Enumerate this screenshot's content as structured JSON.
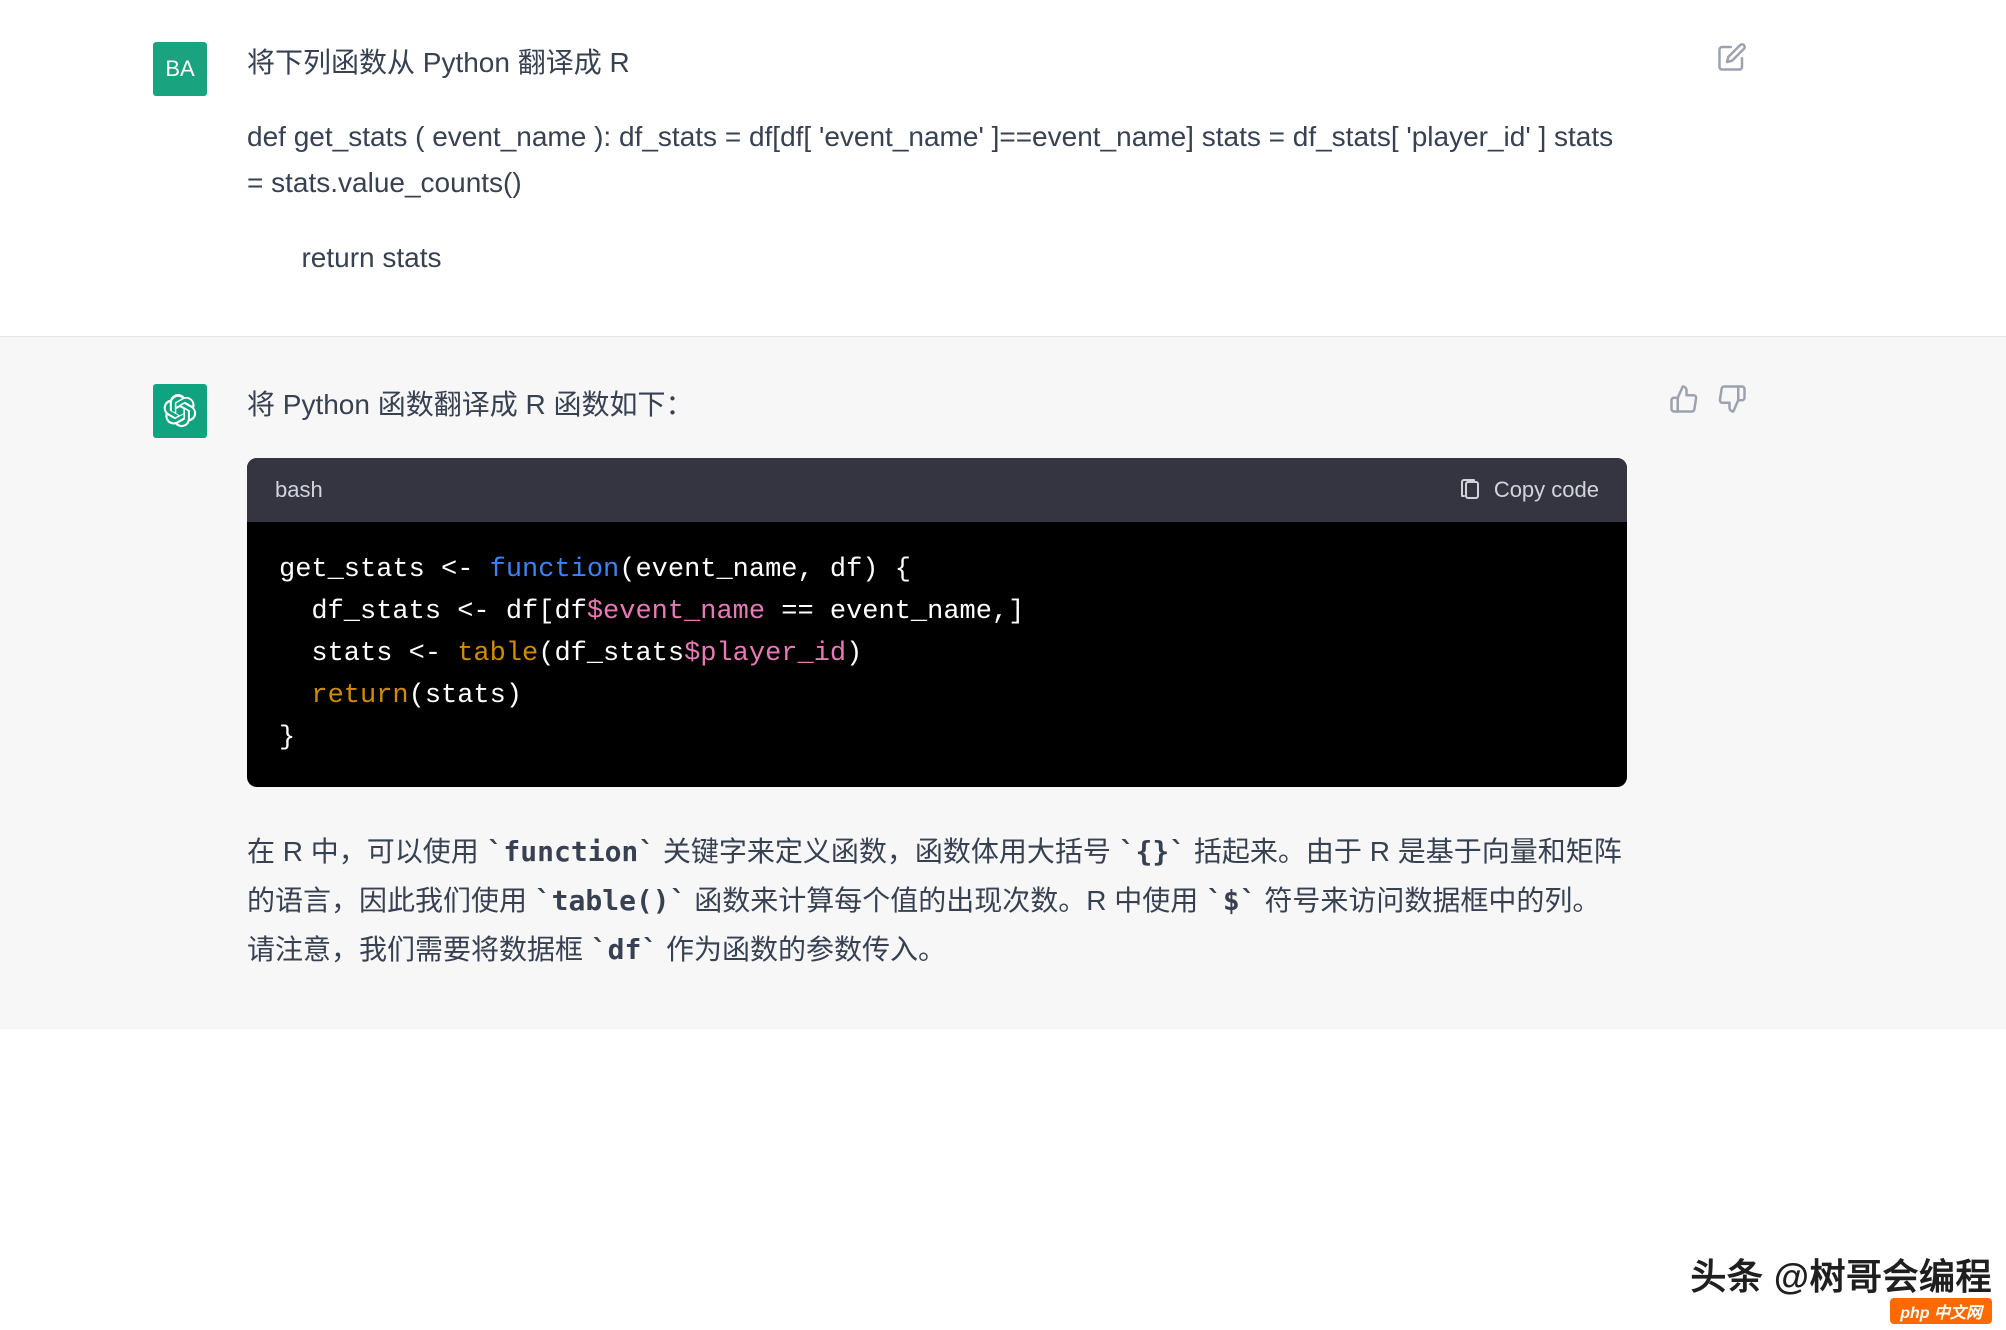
{
  "user": {
    "avatar_label": "BA",
    "prompt_line1": "将下列函数从 Python 翻译成 R",
    "code_line1": "def get_stats ( event_name ):       df_stats = df[df[ 'event_name' ]==event_name]       stats = df_stats[ 'player_id' ]       stats = stats.value_counts()",
    "code_line2": "       return stats"
  },
  "assistant": {
    "intro": "将 Python 函数翻译成 R 函数如下：",
    "code_lang": "bash",
    "copy_label": "Copy code",
    "code": {
      "l1a": "get_stats <- ",
      "l1b": "function",
      "l1c": "(event_name, df) {",
      "l2a": "  df_stats <- df[df",
      "l2b": "$event_name",
      "l2c": " == event_name,]",
      "l3a": "  stats <- ",
      "l3b": "table",
      "l3c": "(df_stats",
      "l3d": "$player_id",
      "l3e": ")",
      "l4a": "  ",
      "l4b": "return",
      "l4c": "(stats)",
      "l5": "}"
    },
    "explain": "在 R 中，可以使用 `function` 关键字来定义函数，函数体用大括号 `{}` 括起来。由于 R 是基于向量和矩阵的语言，因此我们使用 `table()` 函数来计算每个值的出现次数。R 中使用 `$` 符号来访问数据框中的列。请注意，我们需要将数据框 `df` 作为函数的参数传入。"
  },
  "watermark": {
    "text": "头条 @树哥会编程",
    "badge": "php 中文网"
  }
}
